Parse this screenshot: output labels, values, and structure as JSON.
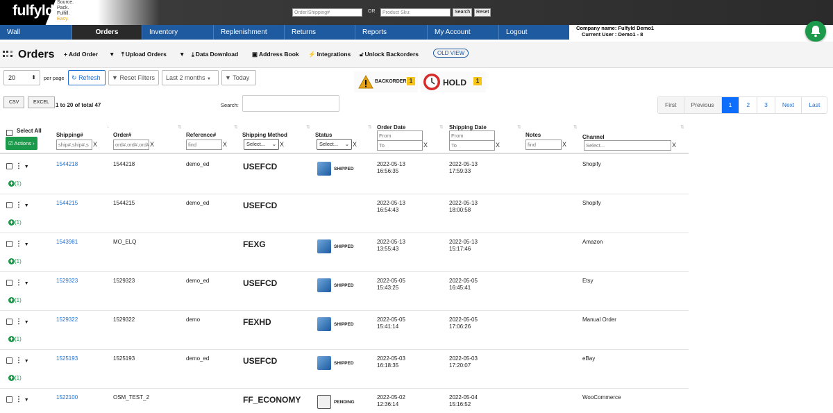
{
  "brand": {
    "logo": "fulfyld",
    "tagline": [
      "Source.",
      "Pack.",
      "Fulfill.",
      "Easy."
    ]
  },
  "topsearch": {
    "order_placeholder": "Order/Shipping#",
    "or": "OR",
    "sku_placeholder": "Product Sku:",
    "search": "Search",
    "reset": "Reset"
  },
  "nav": [
    "Wall",
    "Orders",
    "Inventory",
    "Replenishment",
    "Returns",
    "Reports",
    "My Account",
    "Logout"
  ],
  "company": {
    "line1": "Company name: Fulfyld Demo1",
    "line2": "Current User : Demo1 - 8"
  },
  "toolbar": {
    "title": "Orders",
    "add_order": "Add Order",
    "upload_orders": "Upload Orders",
    "data_download": "Data Download",
    "address_book": "Address Book",
    "integrations": "Integrations",
    "unlock_backorders": "Unlock Backorders",
    "old_view": "OLD VIEW"
  },
  "controls": {
    "per_page_value": "20",
    "per_page": "per page",
    "refresh": "Refresh",
    "reset_filters": "Reset Filters",
    "date_range": "Last 2 months",
    "today": "Today"
  },
  "badges": {
    "backorder": "BACKORDER",
    "backorder_count": "1",
    "hold": "HOLD",
    "hold_count": "1"
  },
  "export": {
    "csv": "CSV",
    "excel": "EXCEL",
    "count": "1 to 20 of total 47",
    "search_label": "Search:"
  },
  "pager": [
    "First",
    "Previous",
    "1",
    "2",
    "3",
    "Next",
    "Last"
  ],
  "columns": {
    "select_all": "Select All",
    "actions": "Actions",
    "shipping": "Shipping#",
    "order": "Order#",
    "reference": "Reference#",
    "method": "Shipping Method",
    "status": "Status",
    "order_date": "Order Date",
    "shipping_date": "Shipping Date",
    "notes": "Notes",
    "channel": "Channel"
  },
  "filters": {
    "ship": "ship#,ship#,s",
    "order": "ord#,ord#,ord#",
    "ref": "find",
    "method": "Select...",
    "status": "Select...",
    "from": "From",
    "to": "To",
    "notes": "find",
    "channel": "Select...",
    "x": "X"
  },
  "rows": [
    {
      "ship": "1544218",
      "order": "1544218",
      "ref": "demo_ed",
      "method": "USEFCD",
      "status": "SHIPPED",
      "odate": "2022-05-13",
      "otime": "16:56:35",
      "sdate": "2022-05-13",
      "stime": "17:59:33",
      "channel": "Shopify",
      "plus": "(1)"
    },
    {
      "ship": "1544215",
      "order": "1544215",
      "ref": "demo_ed",
      "method": "USEFCD",
      "status": "",
      "odate": "2022-05-13",
      "otime": "16:54:43",
      "sdate": "2022-05-13",
      "stime": "18:00:58",
      "channel": "Shopify",
      "plus": "(1)"
    },
    {
      "ship": "1543981",
      "order": "MO_ELQ",
      "ref": "",
      "method": "FEXG",
      "status": "SHIPPED",
      "odate": "2022-05-13",
      "otime": "13:55:43",
      "sdate": "2022-05-13",
      "stime": "15:17:46",
      "channel": "Amazon",
      "plus": "(1)"
    },
    {
      "ship": "1529323",
      "order": "1529323",
      "ref": "demo_ed",
      "method": "USEFCD",
      "status": "SHIPPED",
      "odate": "2022-05-05",
      "otime": "15:43:25",
      "sdate": "2022-05-05",
      "stime": "16:45:41",
      "channel": "Etsy",
      "plus": "(1)"
    },
    {
      "ship": "1529322",
      "order": "1529322",
      "ref": "demo",
      "method": "FEXHD",
      "status": "SHIPPED",
      "odate": "2022-05-05",
      "otime": "15:41:14",
      "sdate": "2022-05-05",
      "stime": "17:06:26",
      "channel": "Manual Order",
      "plus": "(1)"
    },
    {
      "ship": "1525193",
      "order": "1525193",
      "ref": "demo_ed",
      "method": "USEFCD",
      "status": "SHIPPED",
      "odate": "2022-05-03",
      "otime": "16:18:35",
      "sdate": "2022-05-03",
      "stime": "17:20:07",
      "channel": "eBay",
      "plus": "(1)"
    },
    {
      "ship": "1522100",
      "order": "OSM_TEST_2",
      "ref": "",
      "method": "FF_ECONOMY",
      "status": "PENDING",
      "odate": "2022-05-02",
      "otime": "12:36:14",
      "sdate": "2022-05-04",
      "stime": "15:16:52",
      "channel": "WooCommerce",
      "plus": "(1)"
    }
  ],
  "colors": {
    "nav": "#1e5aa0",
    "green": "#1a9a4a",
    "link": "#1e6fd0"
  }
}
